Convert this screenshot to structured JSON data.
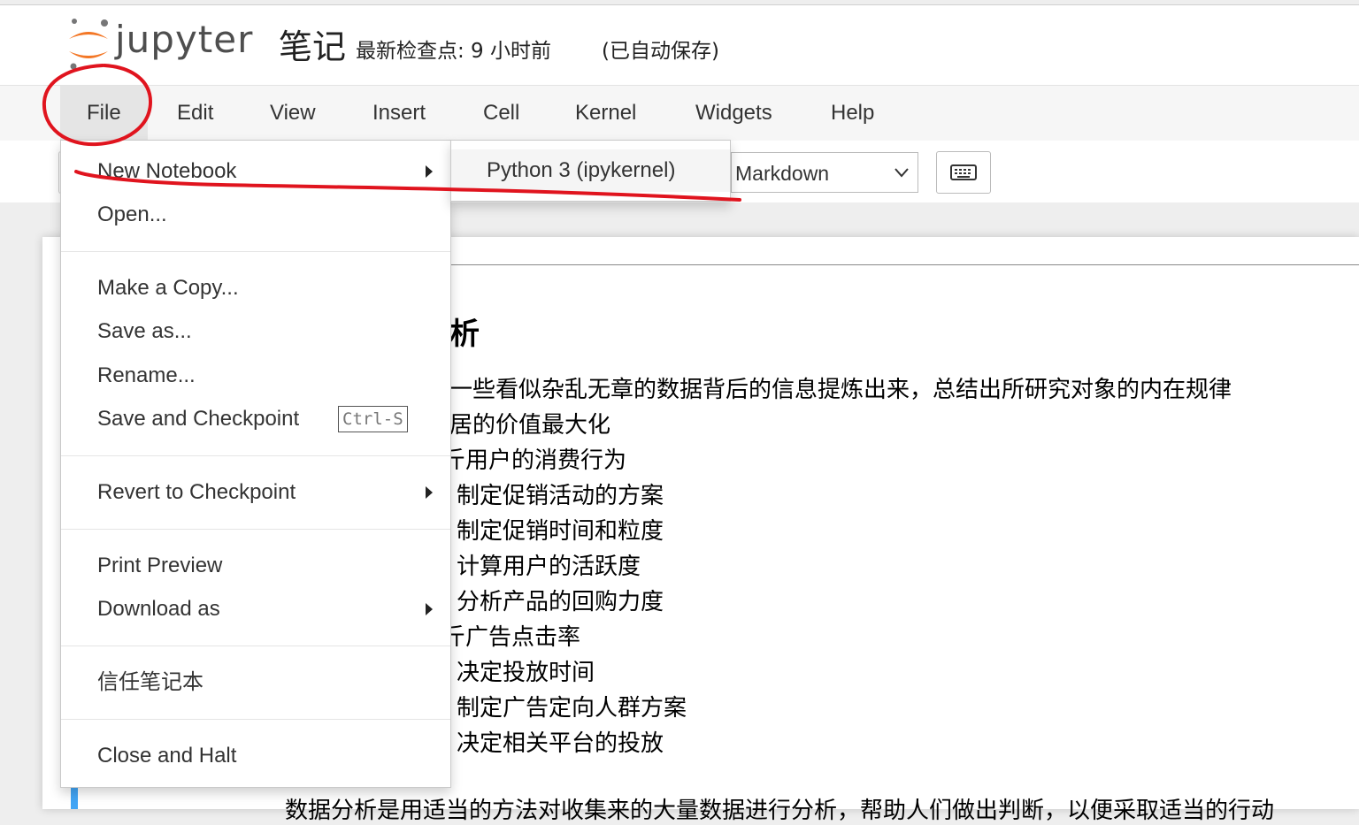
{
  "header": {
    "logo_text": "jupyter",
    "notebook_title": "笔记",
    "checkpoint": "最新检查点: 9 小时前",
    "autosave": "(已自动保存)"
  },
  "menubar": [
    "File",
    "Edit",
    "View",
    "Insert",
    "Cell",
    "Kernel",
    "Widgets",
    "Help"
  ],
  "toolbar": {
    "cell_type": "Markdown",
    "keyboard_icon": "keyboard-icon"
  },
  "file_menu": {
    "new_notebook": "New Notebook",
    "open": "Open...",
    "make_copy": "Make a Copy...",
    "save_as": "Save as...",
    "rename": "Rename...",
    "save_checkpoint": "Save and Checkpoint",
    "save_checkpoint_shortcut": "Ctrl-S",
    "revert": "Revert to Checkpoint",
    "print_preview": "Print Preview",
    "download_as": "Download as",
    "trust": "信任笔记本",
    "close_halt": "Close and Halt"
  },
  "submenu": {
    "kernel": "Python 3 (ipykernel)"
  },
  "cell": {
    "heading": "析",
    "lines": [
      "一些看似杂乱无章的数据背后的信息提炼出来，总结出所研究对象的内在规律",
      "居的价值最大化",
      "斤用户的消费行为",
      "制定促销活动的方案",
      "制定促销时间和粒度",
      "计算用户的活跃度",
      "分析产品的回购力度",
      "斤广告点击率",
      "决定投放时间",
      "制定广告定向人群方案",
      "决定相关平台的投放"
    ],
    "bottom_line": "数据分析是用适当的方法对收集来的大量数据进行分析，帮助人们做出判断，以便采取适当的行动"
  },
  "colors": {
    "annotation_red": "#e0141e",
    "logo_orange": "#f37726",
    "cell_bar_blue": "#42a5f5"
  }
}
